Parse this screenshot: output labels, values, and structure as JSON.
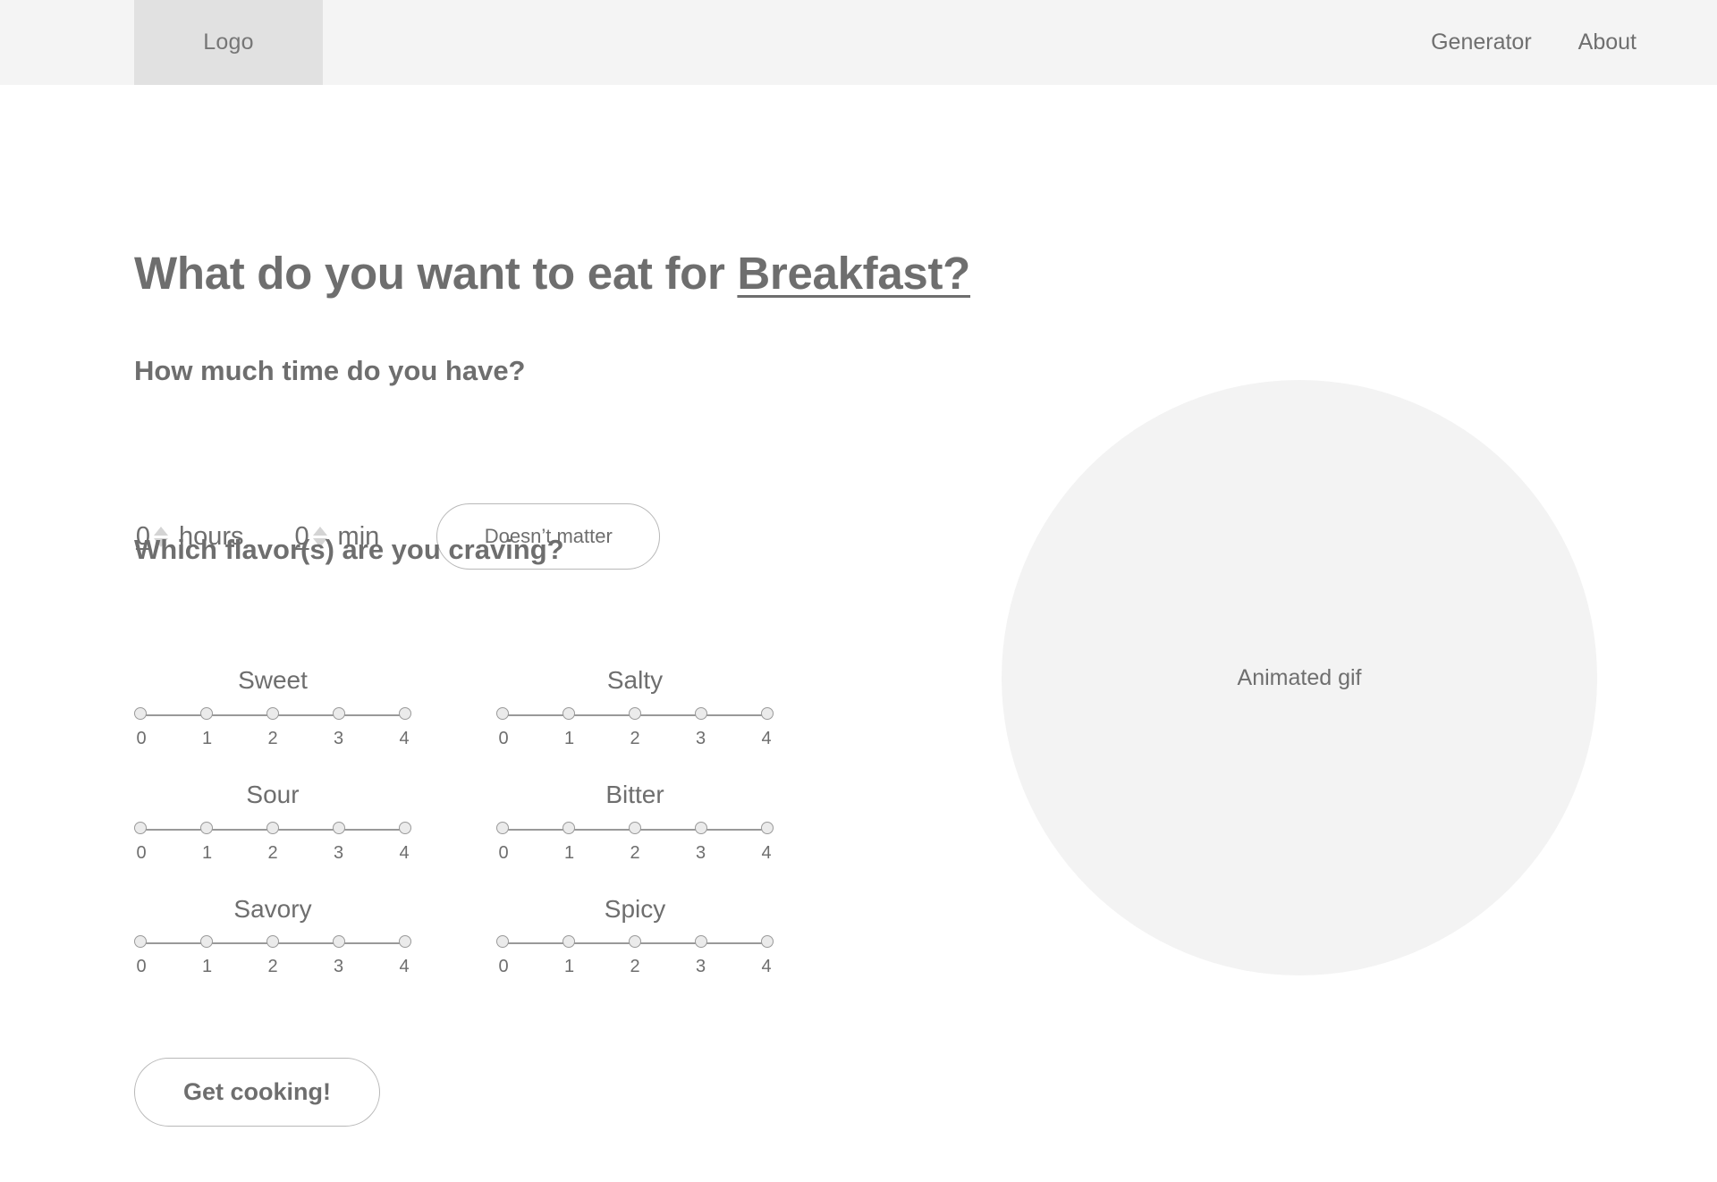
{
  "header": {
    "logo_label": "Logo",
    "nav_items": [
      {
        "label": "Generator"
      },
      {
        "label": "About"
      }
    ]
  },
  "main": {
    "title_prefix": "What do you want to eat for ",
    "title_meal": "Breakfast?",
    "time_question": "How much time do you have?",
    "flavor_question": "Which flavor(s) are you craving?",
    "time": {
      "hours_value": "0",
      "hours_label": "hours",
      "minutes_value": "0",
      "minutes_label": "min",
      "no_preference_label": "Doesn’t matter"
    },
    "sliders": [
      {
        "label": "Sweet",
        "value": 0,
        "ticks": [
          "0",
          "1",
          "2",
          "3",
          "4"
        ]
      },
      {
        "label": "Salty",
        "value": 0,
        "ticks": [
          "0",
          "1",
          "2",
          "3",
          "4"
        ]
      },
      {
        "label": "Sour",
        "value": 0,
        "ticks": [
          "0",
          "1",
          "2",
          "3",
          "4"
        ]
      },
      {
        "label": "Bitter",
        "value": 0,
        "ticks": [
          "0",
          "1",
          "2",
          "3",
          "4"
        ]
      },
      {
        "label": "Savory",
        "value": 0,
        "ticks": [
          "0",
          "1",
          "2",
          "3",
          "4"
        ]
      },
      {
        "label": "Spicy",
        "value": 0,
        "ticks": [
          "0",
          "1",
          "2",
          "3",
          "4"
        ]
      }
    ],
    "submit_label": "Get cooking!",
    "media_placeholder_label": "Animated gif"
  },
  "colors": {
    "text": "#6e6e6e",
    "header_bg": "#f4f4f4",
    "logo_bg": "#e1e1e1",
    "circle_bg": "#f3f3f3",
    "border": "#b8b8b8",
    "slider_line": "#999999",
    "slider_dot_fill": "#ebebeb",
    "arrow": "#d4d4d4"
  }
}
